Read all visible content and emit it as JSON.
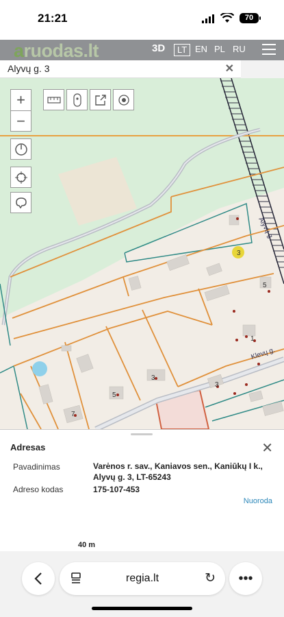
{
  "status": {
    "time": "21:21",
    "battery": "70"
  },
  "topbar": {
    "logo_prefix": "a",
    "logo_rest": "ruodas.lt",
    "nav": [
      "3D",
      "LT",
      "EN",
      "PL",
      "RU"
    ]
  },
  "search": {
    "query": "Alyvų g. 3"
  },
  "map": {
    "street_alyvu": "Alyvų g.",
    "street_klevu": "Klevų g.",
    "house_numbers": [
      "3",
      "5",
      "1",
      "3",
      "5",
      "7",
      "3"
    ],
    "highlight_color": "#e8d63a"
  },
  "panel": {
    "title": "Adresas",
    "name_label": "Pavadinimas",
    "name_line1": "Varėnos r. sav., Kaniavos sen., Kaniūkų I k.,",
    "name_line2": "Alyvų g. 3, LT-65243",
    "code_label": "Adreso kodas",
    "code_value": "175-107-453",
    "link": "Nuoroda",
    "scale": "40 m"
  },
  "browser": {
    "url": "regia.lt"
  }
}
